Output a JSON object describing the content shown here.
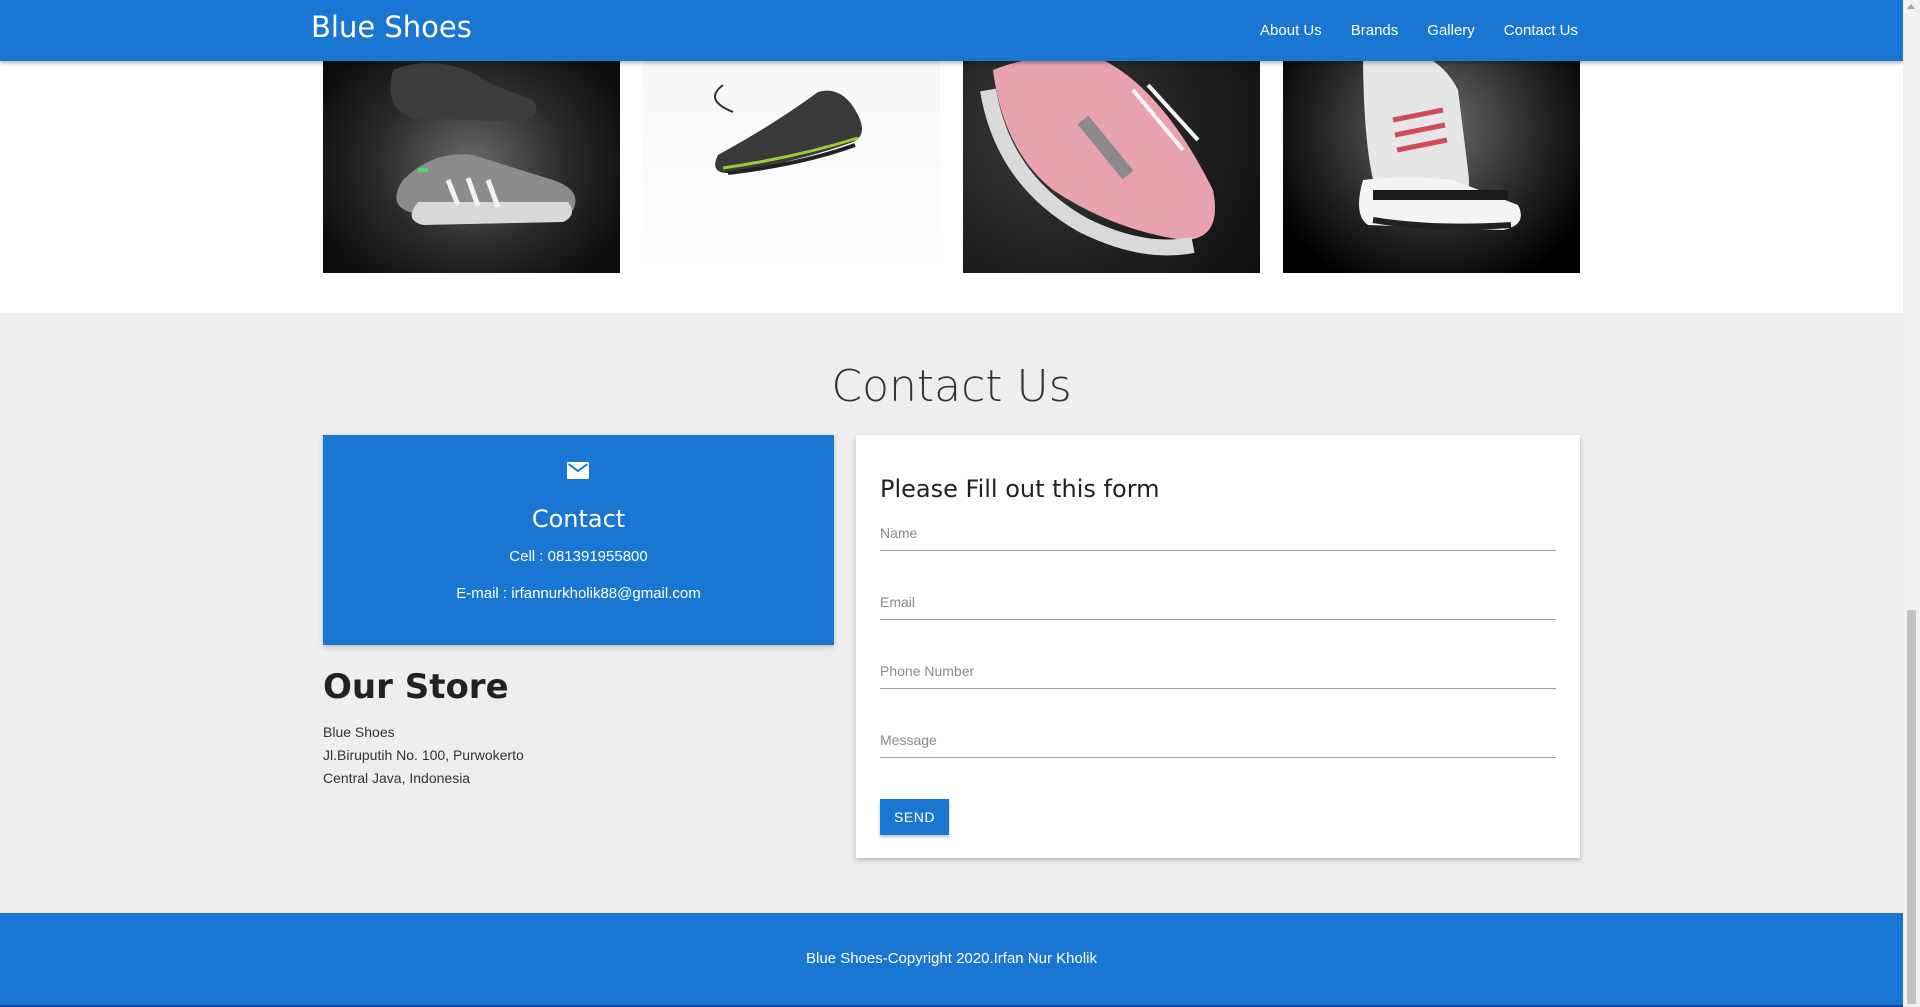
{
  "navbar": {
    "brand": "Blue Shoes",
    "links": [
      "About Us",
      "Brands",
      "Gallery",
      "Contact Us"
    ]
  },
  "gallery": {
    "images": [
      {
        "name": "gallery-image-sneakers-dark-1"
      },
      {
        "name": "gallery-image-sneaker-floating"
      },
      {
        "name": "gallery-image-sneaker-pink"
      },
      {
        "name": "gallery-image-sneakers-dark-2"
      }
    ]
  },
  "contact": {
    "title": "Contact Us",
    "card": {
      "icon": "mail-icon",
      "heading": "Contact",
      "cell": "Cell : 081391955800",
      "email": "E-mail : irfannurkholik88@gmail.com"
    },
    "store": {
      "title": "Our Store",
      "lines": [
        "Blue Shoes",
        "Jl.Biruputih No. 100, Purwokerto",
        "Central Java, Indonesia"
      ]
    },
    "form": {
      "heading": "Please Fill out this form",
      "fields": [
        {
          "placeholder": "Name"
        },
        {
          "placeholder": "Email"
        },
        {
          "placeholder": "Phone Number"
        },
        {
          "placeholder": "Message"
        }
      ],
      "send_label": "SEND"
    }
  },
  "footer": {
    "text": "Blue Shoes-Copyright 2020.Irfan Nur Kholik"
  },
  "colors": {
    "primary": "#1976d2",
    "section_bg": "#eeeeee"
  }
}
